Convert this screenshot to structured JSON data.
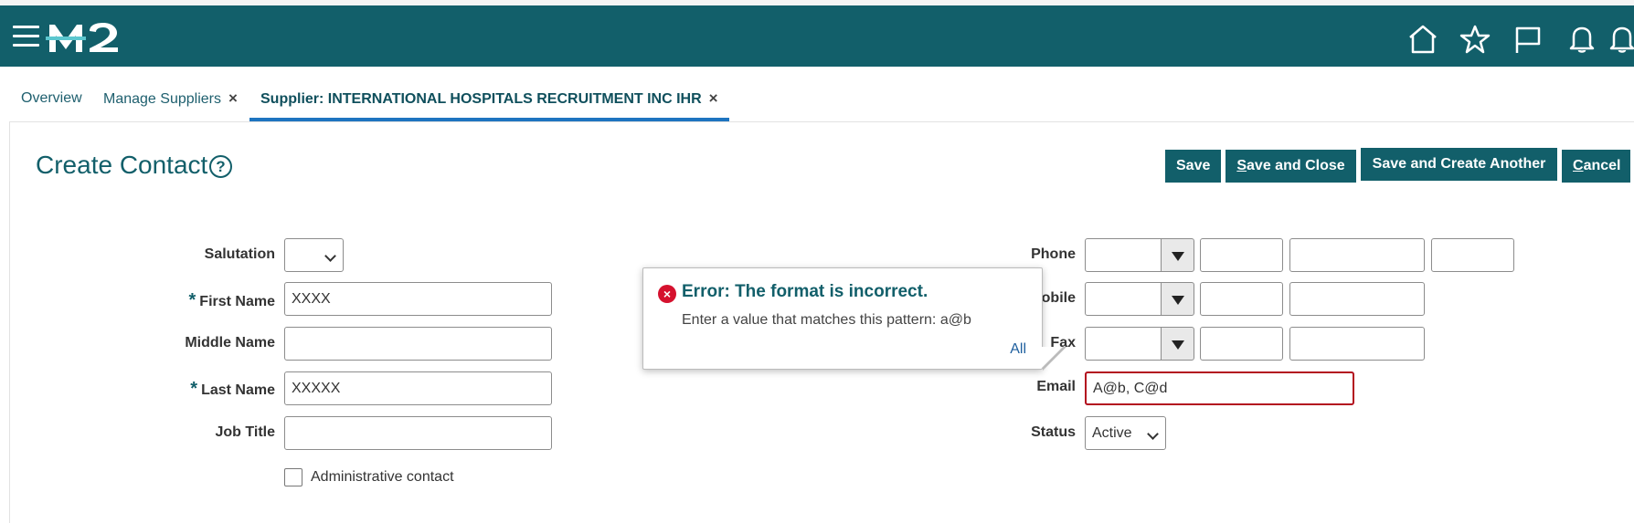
{
  "app": {
    "logo_text": "M2"
  },
  "header": {
    "icons": [
      "menu-icon",
      "home-icon",
      "star-icon",
      "flag-icon",
      "bell-icon",
      "bell-icon"
    ]
  },
  "tabs": [
    {
      "label": "Overview",
      "closable": false
    },
    {
      "label": "Manage Suppliers",
      "closable": true
    },
    {
      "label": "Supplier: INTERNATIONAL HOSPITALS RECRUITMENT INC IHR",
      "closable": true,
      "active": true
    }
  ],
  "close_glyph": "×",
  "page": {
    "title": "Create Contact",
    "help_glyph": "?"
  },
  "actions": {
    "save": "Save",
    "save_close_prefix": "S",
    "save_close_rest": "ave and Close",
    "save_create": "Save and Create Another",
    "cancel_prefix": "C",
    "cancel_rest": "ancel"
  },
  "form_left": {
    "salutation_label": "Salutation",
    "salutation_value": "",
    "required_mark": "*",
    "first_name_label": "First Name",
    "first_name_value": "XXXX",
    "middle_name_label": "Middle Name",
    "middle_name_value": "",
    "last_name_label": "Last Name",
    "last_name_value": "XXXXX",
    "job_title_label": "Job Title",
    "job_title_value": "",
    "admin_contact_label": "Administrative contact"
  },
  "form_right": {
    "phone_label": "Phone",
    "mobile_label": "Mobile",
    "fax_label": "Fax",
    "email_label": "Email",
    "email_value": "A@b, C@d",
    "status_label": "Status",
    "status_value": "Active"
  },
  "error_popup": {
    "title": "Error: The format is incorrect.",
    "message": "Enter a value that matches this pattern: a@b",
    "link": "All",
    "icon_glyph": "×"
  },
  "colors": {
    "brand": "#125f6a",
    "active_tab_underline": "#1e74c0",
    "error": "#d5112e",
    "error_border": "#b30f1f"
  }
}
